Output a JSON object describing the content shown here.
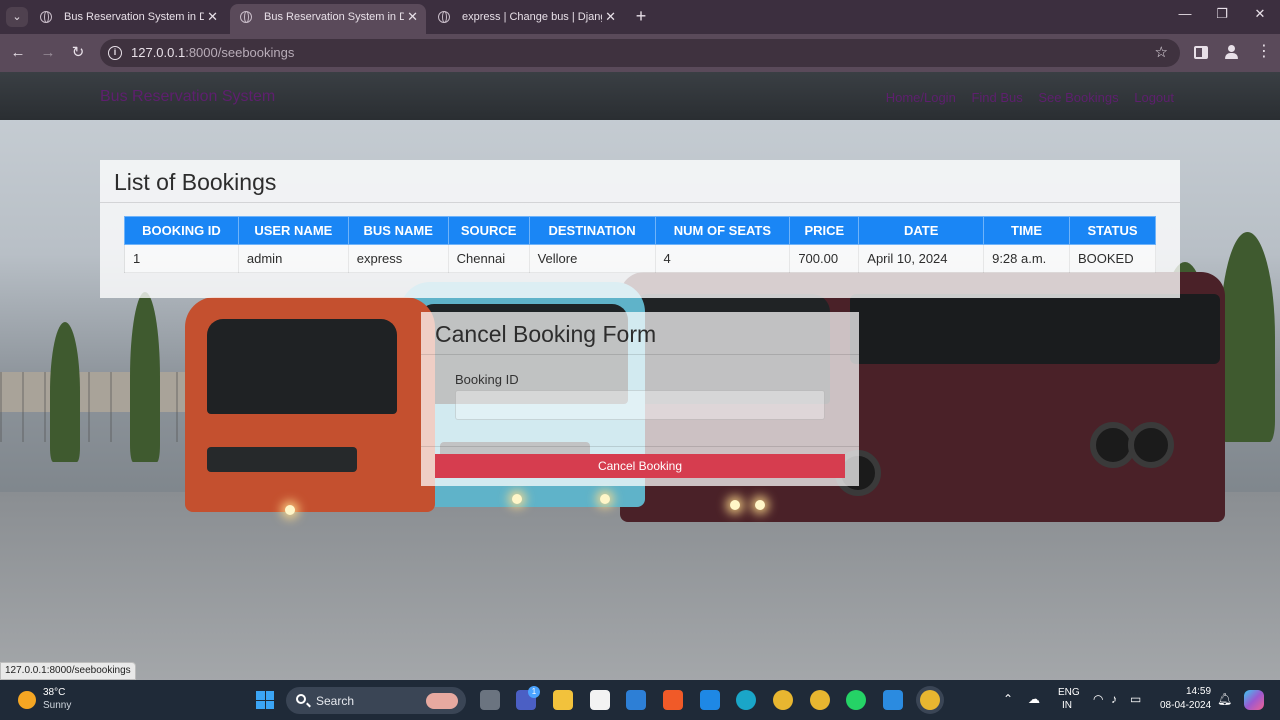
{
  "browser": {
    "tabs": [
      {
        "title": "Bus Reservation System in Djan",
        "close": "✕"
      },
      {
        "title": "Bus Reservation System in Djan",
        "close": "✕"
      },
      {
        "title": "express | Change bus | Django",
        "close": "✕"
      }
    ],
    "new_tab": "+",
    "window_controls": {
      "minimize": "—",
      "maximize": "❐",
      "close": "✕"
    },
    "url_host": "127.0.0.1",
    "url_path": ":8000/seebookings",
    "status_url": "127.0.0.1:8000/seebookings"
  },
  "site": {
    "brand": "Bus Reservation System",
    "nav": [
      "Home/Login",
      "Find Bus",
      "See Bookings",
      "Logout"
    ]
  },
  "bookings": {
    "title": "List of Bookings",
    "columns": [
      "BOOKING ID",
      "USER NAME",
      "BUS NAME",
      "SOURCE",
      "DESTINATION",
      "NUM OF SEATS",
      "PRICE",
      "DATE",
      "TIME",
      "STATUS"
    ],
    "rows": [
      [
        "1",
        "admin",
        "express",
        "Chennai",
        "Vellore",
        "4",
        "700.00",
        "April 10, 2024",
        "9:28 a.m.",
        "BOOKED"
      ]
    ]
  },
  "cancel_form": {
    "title": "Cancel Booking Form",
    "field_label": "Booking ID",
    "field_value": "",
    "button": "Cancel Booking"
  },
  "taskbar": {
    "weather_temp": "38°C",
    "weather_cond": "Sunny",
    "search_label": "Search",
    "teams_badge": "1",
    "lang_line1": "ENG",
    "lang_line2": "IN",
    "time": "14:59",
    "date": "08-04-2024"
  },
  "colors": {
    "table_header": "#1a86f5",
    "cancel_button": "#d63d4f",
    "brand_text": "#5e1f6e"
  }
}
